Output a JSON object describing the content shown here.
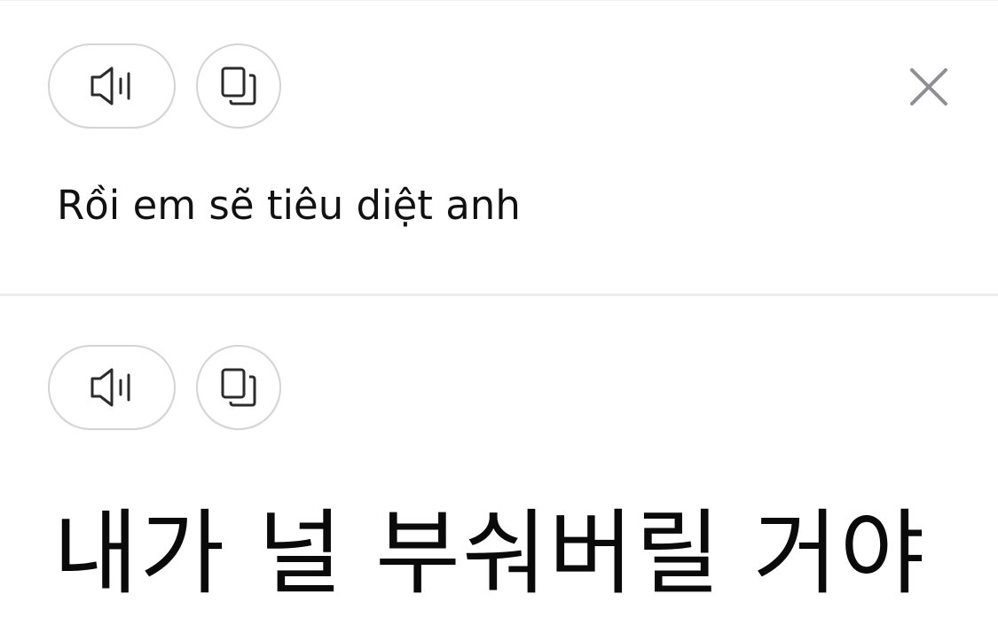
{
  "source": {
    "text": "Rồi em sẽ tiêu diệt anh",
    "speak_icon": "speaker-icon",
    "copy_icon": "copy-icon",
    "close_icon": "close-icon"
  },
  "target": {
    "text": "내가 널 부숴버릴 거야",
    "speak_icon": "speaker-icon",
    "copy_icon": "copy-icon"
  },
  "colors": {
    "icon": "#2b2b2b",
    "close_icon": "#8e8e93",
    "button_border": "#d4d4d4",
    "divider": "#ececec",
    "text": "#111111"
  }
}
